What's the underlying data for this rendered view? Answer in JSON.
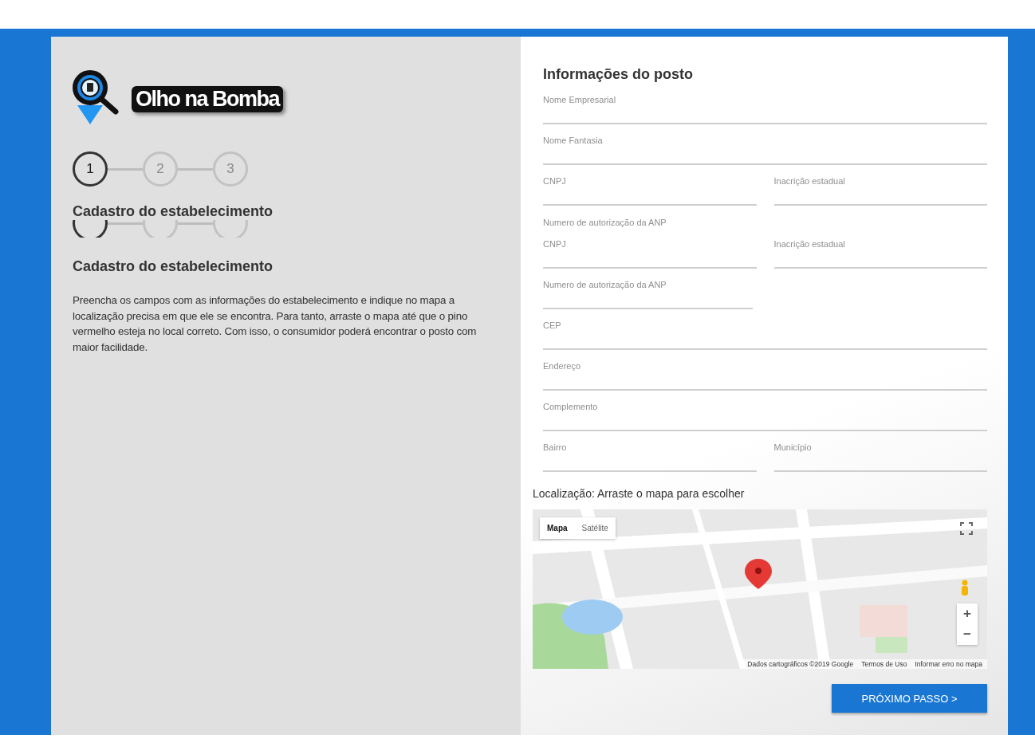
{
  "logo": {
    "text": "Olho na Bomba"
  },
  "steps": [
    {
      "label": "1",
      "selected": true
    },
    {
      "label": "2",
      "selected": false
    },
    {
      "label": "3",
      "selected": false
    }
  ],
  "section_title": "Cadastro do estabelecimento",
  "steps_repeat": [
    {
      "selected": true
    },
    {
      "selected": false
    },
    {
      "selected": false
    }
  ],
  "section_title_repeat": "Cadastro do estabelecimento",
  "description": "Preencha os campos com as informações do estabelecimento e indique no mapa a localização precisa em que ele se encontra. Para tanto, arraste o mapa até que o pino vermelho esteja no local correto. Com isso, o consumidor poderá encontrar o posto com maior facilidade.",
  "form": {
    "title": "Informações do posto",
    "rows": [
      {
        "kind": "full",
        "fields": [
          {
            "placeholder": "Nome Empresarial"
          }
        ]
      },
      {
        "kind": "full",
        "fields": [
          {
            "placeholder": "Nome Fantasia"
          }
        ]
      },
      {
        "kind": "pair",
        "fields": [
          {
            "placeholder": "CNPJ"
          },
          {
            "placeholder": "Inacrição estadual"
          }
        ]
      },
      {
        "kind": "cut",
        "fields": [
          {
            "placeholder": "Numero de autorização da ANP"
          }
        ]
      },
      {
        "kind": "pair",
        "fields": [
          {
            "placeholder": "CNPJ"
          },
          {
            "placeholder": "Inacrição estadual"
          }
        ]
      },
      {
        "kind": "half",
        "fields": [
          {
            "placeholder": "Numero de autorização da ANP"
          }
        ]
      },
      {
        "kind": "full",
        "fields": [
          {
            "placeholder": "CEP"
          }
        ]
      },
      {
        "kind": "full",
        "fields": [
          {
            "placeholder": "Endereço"
          }
        ]
      },
      {
        "kind": "full",
        "fields": [
          {
            "placeholder": "Complemento"
          }
        ]
      },
      {
        "kind": "pair",
        "fields": [
          {
            "placeholder": "Bairro"
          },
          {
            "placeholder": "Município"
          }
        ]
      }
    ]
  },
  "location_label": "Localização: Arraste o mapa para escolher",
  "map": {
    "map_types": [
      {
        "label": "Mapa",
        "selected": true
      },
      {
        "label": "Satélite",
        "selected": false
      }
    ],
    "zoom_in": "+",
    "zoom_out": "−",
    "attribution": [
      "Dados cartográficos ©2019 Google",
      "Termos de Uso",
      "Informar erro no mapa"
    ]
  },
  "next_button": "PRÓXIMO PASSO >"
}
